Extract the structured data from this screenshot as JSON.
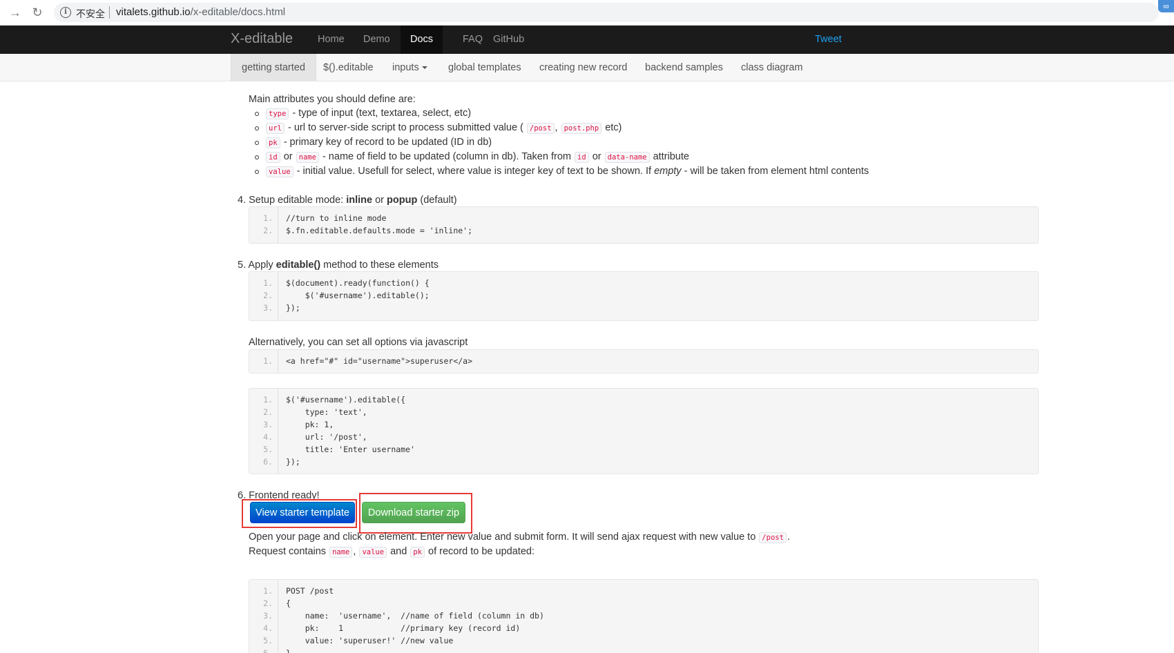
{
  "browser": {
    "insecure_label": "不安全",
    "url_host": "vitalets.github.io",
    "url_path": "/x-editable/docs.html"
  },
  "navbar": {
    "brand": "X-editable",
    "items": [
      "Home",
      "Demo",
      "Docs",
      "FAQ",
      "GitHub"
    ],
    "active": "Docs",
    "tweet": "Tweet"
  },
  "subnav": {
    "items": [
      "getting started",
      "$().editable",
      "inputs",
      "global templates",
      "creating new record",
      "backend samples",
      "class diagram"
    ],
    "active": "getting started"
  },
  "content": {
    "main_attrs_intro": "Main attributes you should define are:",
    "attrs": {
      "type_code": "type",
      "type_text": "- type of input (text, textarea, select, etc)",
      "url_code": "url",
      "url_text": "- url to server-side script to process submitted value (",
      "url_ex1": "/post",
      "url_comma": ",",
      "url_ex2": "post.php",
      "url_etc": "etc)",
      "pk_code": "pk",
      "pk_text": "- primary key of record to be updated (ID in db)",
      "id_code": "id",
      "or1": "or",
      "name_code": "name",
      "name_text": "- name of field to be updated (column in db). Taken from",
      "id_code2": "id",
      "or2": "or",
      "dataname_code": "data-name",
      "attribute_word": "attribute",
      "value_code": "value",
      "value_text": "- initial value. Usefull for select, where value is integer key of text to be shown. If",
      "value_empty": "empty",
      "value_rest": "- will be taken from element html contents"
    },
    "step4": {
      "num": "4.",
      "text_a": "Setup editable mode:",
      "inline": "inline",
      "or": "or",
      "popup": "popup",
      "default": "(default)"
    },
    "step5": {
      "num": "5.",
      "apply": "Apply",
      "method": "editable()",
      "rest": "method to these elements"
    },
    "alt_text": "Alternatively, you can set all options via javascript",
    "step6": {
      "num": "6.",
      "text": "Frontend ready!"
    },
    "view_button": "View starter template",
    "download_button": "Download starter zip",
    "open_text_a": "Open your page and click on element. Enter new value and submit form. It will send ajax request with new value to",
    "open_code": "/post",
    "open_end": ".",
    "request_text_a": "Request contains",
    "req_name": "name",
    "req_comma": ",",
    "req_value": "value",
    "req_and": "and",
    "req_pk": "pk",
    "req_end": "of record to be updated:"
  },
  "code": {
    "block1": [
      "//turn to inline mode",
      "$.fn.editable.defaults.mode = 'inline';"
    ],
    "block2": [
      "$(document).ready(function() {",
      "    $('#username').editable();",
      "});"
    ],
    "block3": [
      "<a href=\"#\" id=\"username\">superuser</a>"
    ],
    "block4": [
      "$('#username').editable({",
      "    type: 'text',",
      "    pk: 1,",
      "    url: '/post',",
      "    title: 'Enter username'",
      "});"
    ],
    "block5": [
      "POST /post",
      "{",
      "    name:  'username',  //name of field (column in db)",
      "    pk:    1            //primary key (record id)",
      "    value: 'superuser!' //new value",
      "}"
    ],
    "line_numbers": [
      "1.",
      "2.",
      "3.",
      "4.",
      "5.",
      "6."
    ]
  },
  "colors": {
    "navbar_bg": "#1b1b1b",
    "primary_btn": "#0055cc",
    "success_btn": "#5bb75b",
    "highlight": "#e53935",
    "code_string": "#dd1144"
  }
}
